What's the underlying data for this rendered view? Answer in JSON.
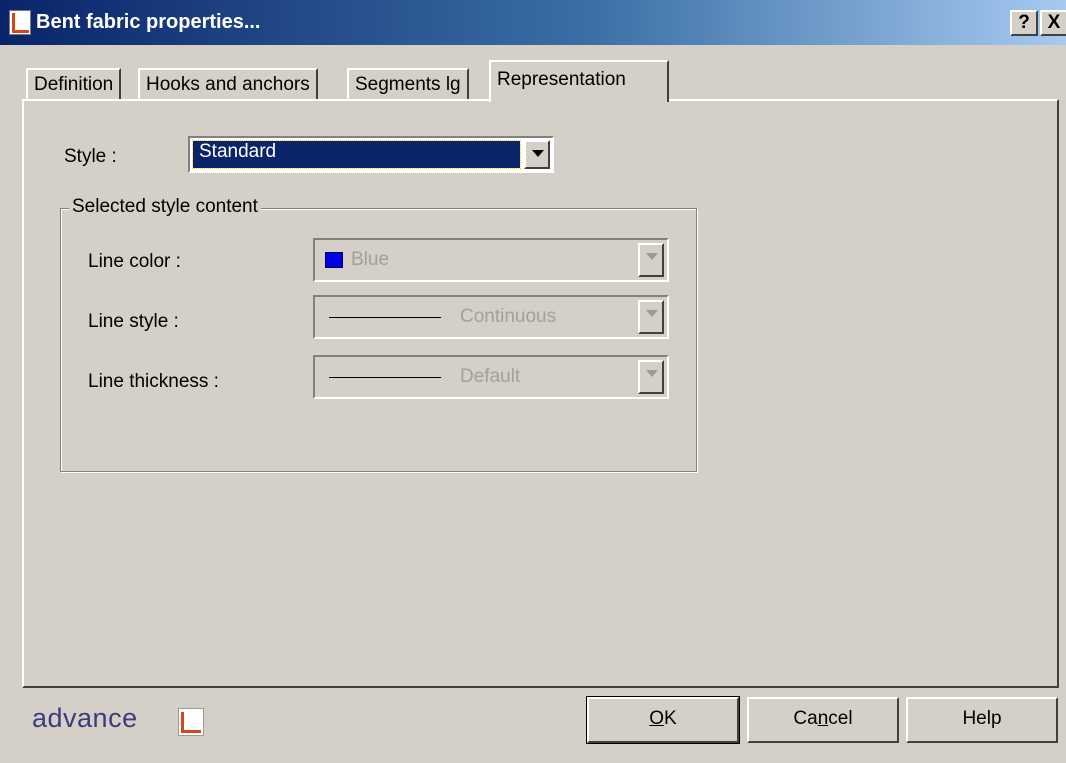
{
  "window": {
    "title": "Bent fabric properties...",
    "help_button": "?",
    "close_button": "X"
  },
  "tabs": [
    {
      "label": "Definition",
      "active": false
    },
    {
      "label": "Hooks and anchors",
      "active": false
    },
    {
      "label": "Segments lg",
      "active": false
    },
    {
      "label": "Representation",
      "active": true
    }
  ],
  "style": {
    "label": "Style :",
    "value": "Standard"
  },
  "group": {
    "title": "Selected style content",
    "rows": [
      {
        "label": "Line color :",
        "value": "Blue",
        "swatch_color": "#0000e0"
      },
      {
        "label": "Line style :",
        "value": "Continuous"
      },
      {
        "label": "Line thickness :",
        "value": "Default"
      }
    ]
  },
  "footer": {
    "logo_text": "advance",
    "ok_prefix": "",
    "ok_mnemonic": "O",
    "ok_suffix": "K",
    "cancel_prefix": "Ca",
    "cancel_mnemonic": "n",
    "cancel_suffix": "cel",
    "help_label": "Help"
  }
}
